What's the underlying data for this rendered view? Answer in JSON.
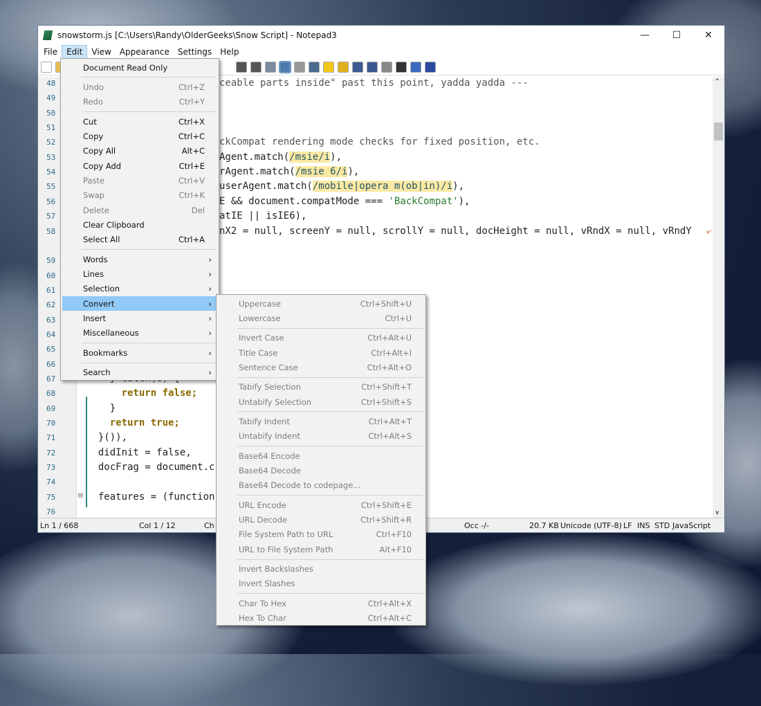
{
  "window": {
    "title": "snowstorm.js [C:\\Users\\Randy\\OlderGeeks\\Snow Script] - Notepad3",
    "minimize": "—",
    "maximize": "☐",
    "close": "✕"
  },
  "menubar": [
    "File",
    "Edit",
    "View",
    "Appearance",
    "Settings",
    "Help"
  ],
  "toolbar_icons": [
    "new-file-icon",
    "open-icon",
    "find-icon",
    "replace-icon",
    "view-icon",
    "wordwrap-icon",
    "scheme-icon",
    "zoom-find-icon",
    "bookmark-icon",
    "bookmark-add-icon",
    "zoom-in-icon",
    "zoom-out-icon",
    "list-icon",
    "terminal-icon",
    "pin-icon",
    "close-circle-icon"
  ],
  "editor": {
    "line_numbers": [
      "48",
      "49",
      "50",
      "51",
      "52",
      "53",
      "54",
      "55",
      "56",
      "57",
      "58",
      "59",
      "60",
      "61",
      "62",
      "63",
      "64",
      "65",
      "66",
      "67",
      "68",
      "69",
      "70",
      "71",
      "72",
      "73",
      "74",
      "75",
      "76"
    ],
    "top_fragments": [
      {
        "line": "48",
        "text": "ceable parts inside\" past this point, yadda yadda ---"
      },
      {
        "line": "52",
        "text": "ckCompat rendering mode checks for fixed position, etc."
      },
      {
        "line": "53",
        "pre": "Agent.match(",
        "rx": "/msie/i",
        "post": "),"
      },
      {
        "line": "54",
        "pre": "rAgent.match(",
        "rx": "/msie 6/i",
        "post": "),"
      },
      {
        "line": "55",
        "pre": "userAgent.match(",
        "rx": "/mobile|opera m(ob|in)/i",
        "post": "),"
      },
      {
        "line": "56",
        "pre": "E && document.compatMode === ",
        "str": "'BackCompat'",
        "post": "),"
      },
      {
        "line": "57",
        "text": "atIE || isIE6),"
      },
      {
        "line": "58",
        "text": "nX2 = null, screenY = null, scrollY = null, docHeight = null, vRndX = null, vRndY"
      }
    ],
    "bottom_lines": [
      {
        "line": "67",
        "text": "    } catch(e) {"
      },
      {
        "line": "68",
        "kw": "return false;",
        "indent": "      "
      },
      {
        "line": "69",
        "text": "    }"
      },
      {
        "line": "70",
        "kw": "return true;",
        "indent": "    "
      },
      {
        "line": "71",
        "text": "  }()),"
      },
      {
        "line": "72",
        "text": "  didInit = false,"
      },
      {
        "line": "73",
        "text": "  docFrag = document.c"
      },
      {
        "line": "75",
        "text": "  features = (function"
      }
    ]
  },
  "status": {
    "ln": "Ln 1 / 668",
    "col": "Col 1 / 12",
    "ch": "Ch",
    "occ": "Occ -/-",
    "size": "20.7 KB",
    "encoding": "Unicode (UTF-8)",
    "eol": "LF",
    "ins": "INS",
    "std": "STD",
    "lexer": "JavaScript"
  },
  "edit_menu": [
    {
      "label": "Document Read Only"
    },
    {
      "sep": true
    },
    {
      "label": "Undo",
      "shortcut": "Ctrl+Z",
      "disabled": true
    },
    {
      "label": "Redo",
      "shortcut": "Ctrl+Y",
      "disabled": true
    },
    {
      "sep": true
    },
    {
      "label": "Cut",
      "shortcut": "Ctrl+X"
    },
    {
      "label": "Copy",
      "shortcut": "Ctrl+C"
    },
    {
      "label": "Copy All",
      "shortcut": "Alt+C"
    },
    {
      "label": "Copy Add",
      "shortcut": "Ctrl+E"
    },
    {
      "label": "Paste",
      "shortcut": "Ctrl+V",
      "disabled": true
    },
    {
      "label": "Swap",
      "shortcut": "Ctrl+K",
      "disabled": true
    },
    {
      "label": "Delete",
      "shortcut": "Del",
      "disabled": true
    },
    {
      "label": "Clear Clipboard"
    },
    {
      "label": "Select All",
      "shortcut": "Ctrl+A"
    },
    {
      "sep": true
    },
    {
      "label": "Words",
      "sub": true
    },
    {
      "label": "Lines",
      "sub": true
    },
    {
      "label": "Selection",
      "sub": true
    },
    {
      "label": "Convert",
      "sub": true,
      "highlight": true
    },
    {
      "label": "Insert",
      "sub": true
    },
    {
      "label": "Miscellaneous",
      "sub": true
    },
    {
      "sep": true
    },
    {
      "label": "Bookmarks",
      "sub": true
    },
    {
      "sep": true
    },
    {
      "label": "Search",
      "sub": true
    }
  ],
  "convert_menu": [
    {
      "label": "Uppercase",
      "shortcut": "Ctrl+Shift+U"
    },
    {
      "label": "Lowercase",
      "shortcut": "Ctrl+U"
    },
    {
      "sep": true
    },
    {
      "label": "Invert Case",
      "shortcut": "Ctrl+Alt+U"
    },
    {
      "label": "Title Case",
      "shortcut": "Ctrl+Alt+I"
    },
    {
      "label": "Sentence Case",
      "shortcut": "Ctrl+Alt+O"
    },
    {
      "sep": true
    },
    {
      "label": "Tabify Selection",
      "shortcut": "Ctrl+Shift+T"
    },
    {
      "label": "Untabify Selection",
      "shortcut": "Ctrl+Shift+S"
    },
    {
      "sep": true
    },
    {
      "label": "Tabify Indent",
      "shortcut": "Ctrl+Alt+T"
    },
    {
      "label": "Untabify Indent",
      "shortcut": "Ctrl+Alt+S"
    },
    {
      "sep": true
    },
    {
      "label": "Base64 Encode"
    },
    {
      "label": "Base64 Decode"
    },
    {
      "label": "Base64 Decode to codepage..."
    },
    {
      "sep": true
    },
    {
      "label": "URL Encode",
      "shortcut": "Ctrl+Shift+E"
    },
    {
      "label": "URL Decode",
      "shortcut": "Ctrl+Shift+R"
    },
    {
      "label": "File System Path to URL",
      "shortcut": "Ctrl+F10"
    },
    {
      "label": "URL to File System Path",
      "shortcut": "Alt+F10"
    },
    {
      "sep": true
    },
    {
      "label": "Invert Backslashes"
    },
    {
      "label": "Invert Slashes"
    },
    {
      "sep": true
    },
    {
      "label": "Char To Hex",
      "shortcut": "Ctrl+Alt+X"
    },
    {
      "label": "Hex To Char",
      "shortcut": "Ctrl+Alt+C"
    }
  ],
  "colors": {
    "highlight": "#91c9f7",
    "regex_bg": "#fbe9a3",
    "keyword": "#8a6a00",
    "line_number": "#2b6a8a"
  }
}
